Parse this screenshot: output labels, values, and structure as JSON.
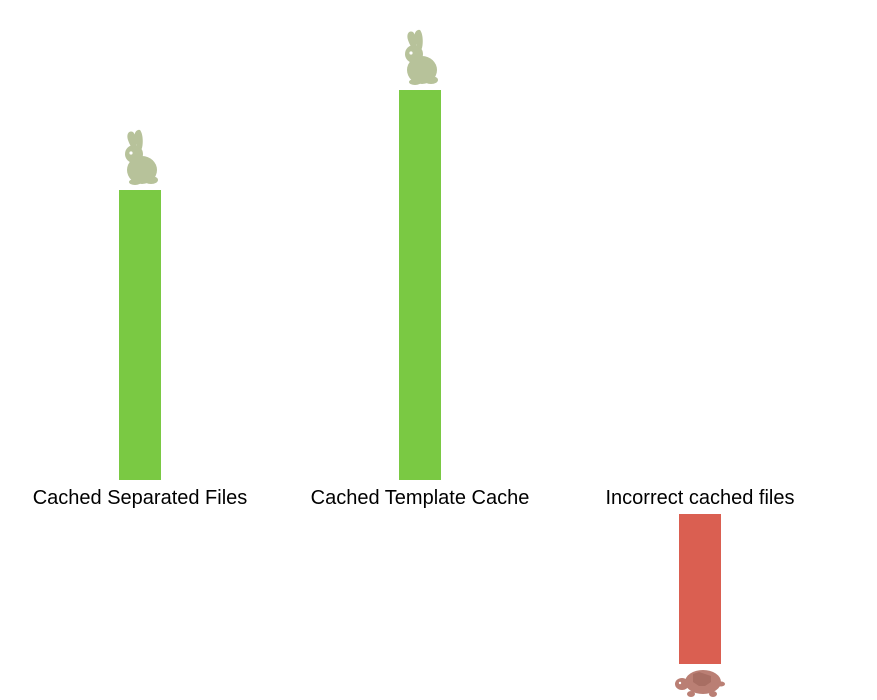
{
  "chart_data": {
    "type": "bar",
    "categories": [
      "Cached Separated Files",
      "Cached Template Cache",
      "Incorrect cached files"
    ],
    "values": [
      290,
      390,
      -150
    ],
    "series_icons": [
      "rabbit",
      "rabbit",
      "turtle"
    ],
    "colors": {
      "positive_bar": "#7ac943",
      "negative_bar": "#da5f51",
      "rabbit_icon": "#b7c29a",
      "turtle_icon": "#ba7f74"
    },
    "baseline": 480,
    "title": "",
    "xlabel": "",
    "ylabel": "",
    "ylim": [
      -200,
      420
    ]
  },
  "labels": {
    "c0": "Cached Separated Files",
    "c1": "Cached Template Cache",
    "c2": "Incorrect cached files"
  }
}
